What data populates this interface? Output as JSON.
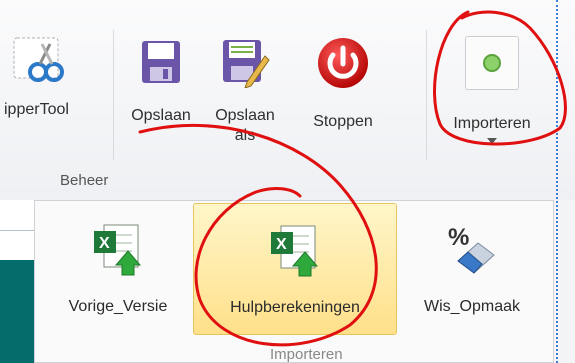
{
  "ribbon": {
    "buttons": [
      {
        "label": "ipperTool",
        "icon": "scissors-icon"
      },
      {
        "label": "Opslaan",
        "icon": "save-icon"
      },
      {
        "label_line1": "Opslaan",
        "label_line2": "als",
        "icon": "save-as-icon"
      },
      {
        "label": "Stoppen",
        "icon": "power-icon"
      },
      {
        "label": "Importeren",
        "icon": "import-icon"
      }
    ],
    "group_label": "Beheer"
  },
  "dropdown": {
    "items": [
      {
        "label": "Vorige_Versie",
        "icon": "excel-import-icon"
      },
      {
        "label": "Hulpberekeningen",
        "icon": "excel-import-icon",
        "selected": true
      },
      {
        "label": "Wis_Opmaak",
        "icon": "clear-format-icon"
      }
    ],
    "group_label": "Importeren"
  },
  "colors": {
    "annotation": "#e01010",
    "selected_bg": "#ffe08a",
    "teal": "#066b6b"
  }
}
